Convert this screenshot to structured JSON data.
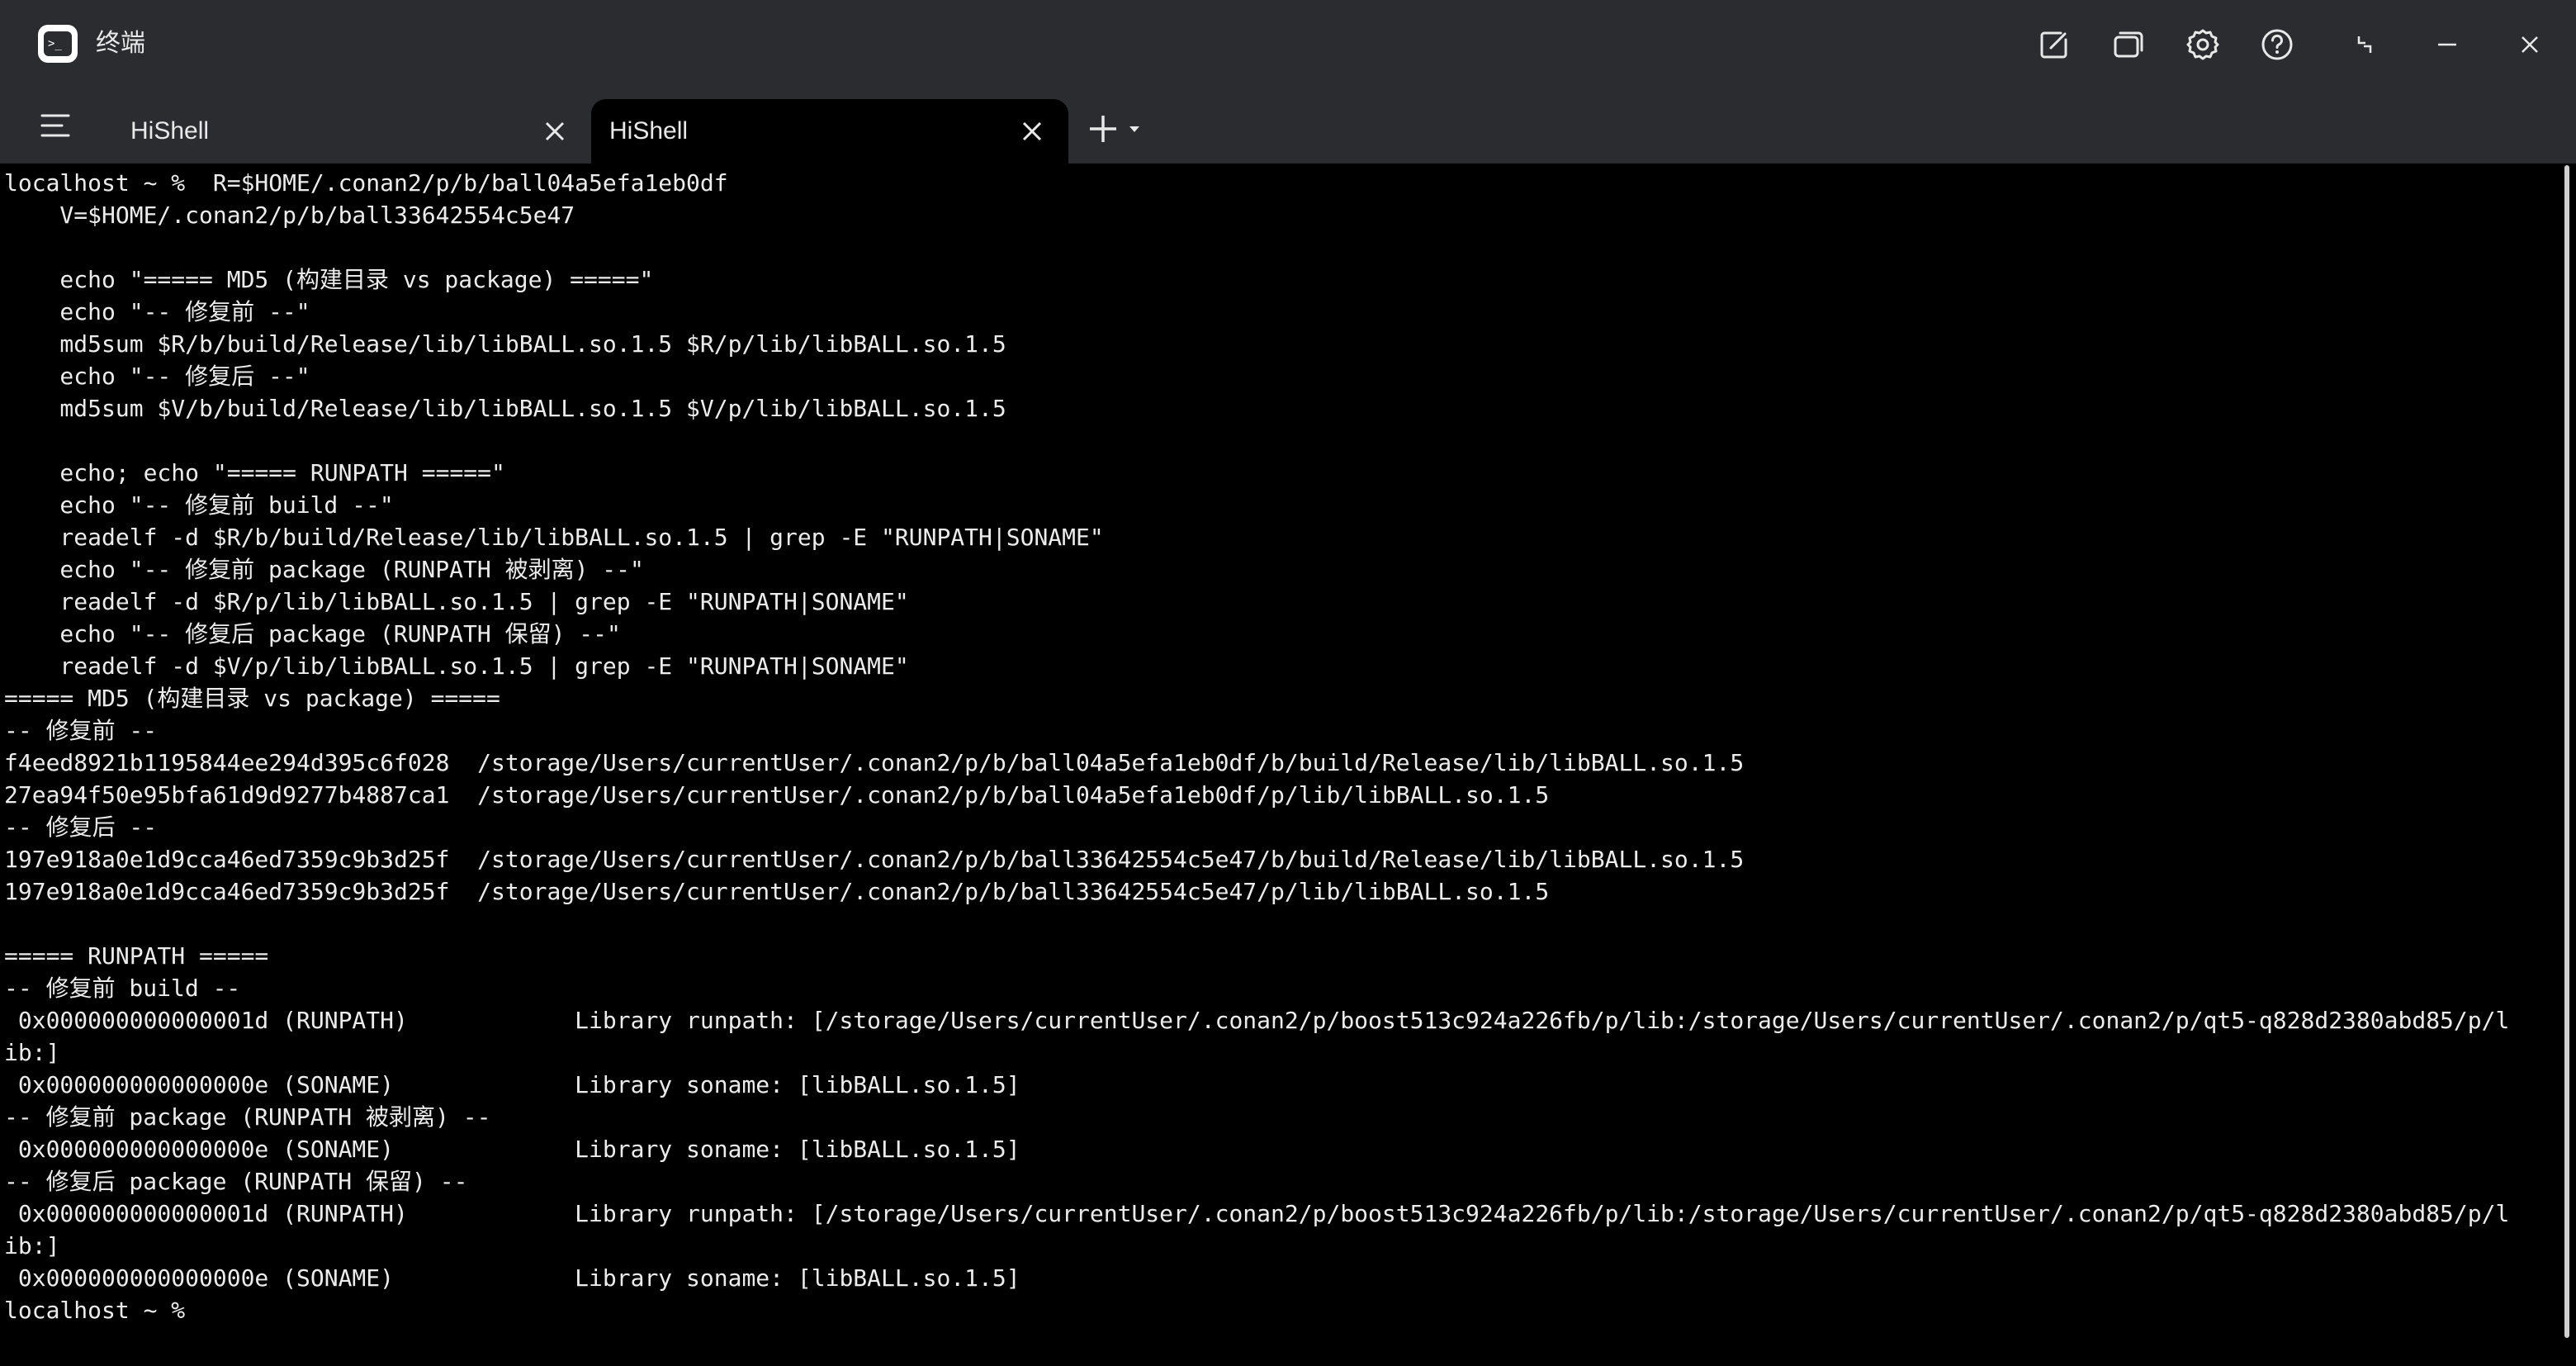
{
  "window": {
    "title": "终端"
  },
  "toolbar": {
    "buttons": [
      {
        "name": "compose-icon",
        "label": "New window"
      },
      {
        "name": "windows-icon",
        "label": "Switch windows"
      },
      {
        "name": "gear-icon",
        "label": "Settings"
      },
      {
        "name": "help-icon",
        "label": "Help"
      },
      {
        "name": "restore-icon",
        "label": "Restore"
      },
      {
        "name": "minimize-icon",
        "label": "Minimize"
      },
      {
        "name": "close-icon",
        "label": "Close"
      }
    ]
  },
  "tabs": [
    {
      "label": "HiShell",
      "active": false
    },
    {
      "label": "HiShell",
      "active": true
    }
  ],
  "colors": {
    "titlebar": "#2b2c2f",
    "terminal_bg": "#000000",
    "terminal_fg": "#ececec"
  },
  "terminal": {
    "lines": [
      "localhost ~ %  R=$HOME/.conan2/p/b/ball04a5efa1eb0df",
      "    V=$HOME/.conan2/p/b/ball33642554c5e47",
      "",
      "    echo \"===== MD5 (构建目录 vs package) =====\"",
      "    echo \"-- 修复前 --\"",
      "    md5sum $R/b/build/Release/lib/libBALL.so.1.5 $R/p/lib/libBALL.so.1.5",
      "    echo \"-- 修复后 --\"",
      "    md5sum $V/b/build/Release/lib/libBALL.so.1.5 $V/p/lib/libBALL.so.1.5",
      "",
      "    echo; echo \"===== RUNPATH =====\"",
      "    echo \"-- 修复前 build --\"",
      "    readelf -d $R/b/build/Release/lib/libBALL.so.1.5 | grep -E \"RUNPATH|SONAME\"",
      "    echo \"-- 修复前 package (RUNPATH 被剥离) --\"",
      "    readelf -d $R/p/lib/libBALL.so.1.5 | grep -E \"RUNPATH|SONAME\"",
      "    echo \"-- 修复后 package (RUNPATH 保留) --\"",
      "    readelf -d $V/p/lib/libBALL.so.1.5 | grep -E \"RUNPATH|SONAME\"",
      "===== MD5 (构建目录 vs package) =====",
      "-- 修复前 --",
      "f4eed8921b1195844ee294d395c6f028  /storage/Users/currentUser/.conan2/p/b/ball04a5efa1eb0df/b/build/Release/lib/libBALL.so.1.5",
      "27ea94f50e95bfa61d9d9277b4887ca1  /storage/Users/currentUser/.conan2/p/b/ball04a5efa1eb0df/p/lib/libBALL.so.1.5",
      "-- 修复后 --",
      "197e918a0e1d9cca46ed7359c9b3d25f  /storage/Users/currentUser/.conan2/p/b/ball33642554c5e47/b/build/Release/lib/libBALL.so.1.5",
      "197e918a0e1d9cca46ed7359c9b3d25f  /storage/Users/currentUser/.conan2/p/b/ball33642554c5e47/p/lib/libBALL.so.1.5",
      "",
      "===== RUNPATH =====",
      "-- 修复前 build --",
      " 0x000000000000001d (RUNPATH)            Library runpath: [/storage/Users/currentUser/.conan2/p/boost513c924a226fb/p/lib:/storage/Users/currentUser/.conan2/p/qt5-q828d2380abd85/p/l",
      "ib:]",
      " 0x000000000000000e (SONAME)             Library soname: [libBALL.so.1.5]",
      "-- 修复前 package (RUNPATH 被剥离) --",
      " 0x000000000000000e (SONAME)             Library soname: [libBALL.so.1.5]",
      "-- 修复后 package (RUNPATH 保留) --",
      " 0x000000000000001d (RUNPATH)            Library runpath: [/storage/Users/currentUser/.conan2/p/boost513c924a226fb/p/lib:/storage/Users/currentUser/.conan2/p/qt5-q828d2380abd85/p/l",
      "ib:]",
      " 0x000000000000000e (SONAME)             Library soname: [libBALL.so.1.5]",
      "localhost ~ % "
    ]
  }
}
